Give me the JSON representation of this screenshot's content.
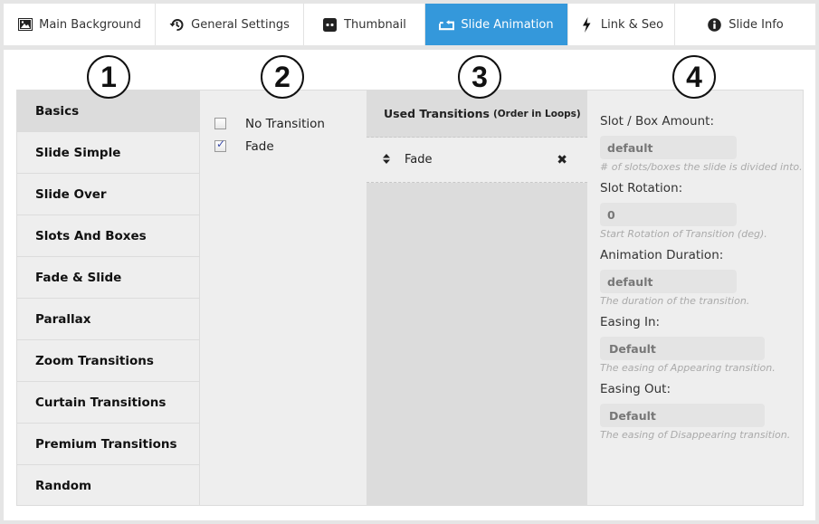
{
  "tabs": [
    {
      "label": "Main Background",
      "icon": "image-icon",
      "active": false
    },
    {
      "label": "General Settings",
      "icon": "history-icon",
      "active": false
    },
    {
      "label": "Thumbnail",
      "icon": "thumbnail-icon",
      "active": false
    },
    {
      "label": "Slide Animation",
      "icon": "loop-icon",
      "active": true
    },
    {
      "label": "Link & Seo",
      "icon": "bolt-icon",
      "active": false
    },
    {
      "label": "Slide Info",
      "icon": "info-icon",
      "active": false
    }
  ],
  "markers": [
    "1",
    "2",
    "3",
    "4"
  ],
  "categories": [
    {
      "label": "Basics",
      "active": true
    },
    {
      "label": "Slide Simple"
    },
    {
      "label": "Slide Over"
    },
    {
      "label": "Slots And Boxes"
    },
    {
      "label": "Fade & Slide"
    },
    {
      "label": "Parallax"
    },
    {
      "label": "Zoom Transitions"
    },
    {
      "label": "Curtain Transitions"
    },
    {
      "label": "Premium Transitions"
    },
    {
      "label": "Random"
    }
  ],
  "transitions": [
    {
      "label": "No Transition",
      "checked": false
    },
    {
      "label": "Fade",
      "checked": true
    }
  ],
  "used": {
    "title": "Used Transitions",
    "subtitle": "(Order in Loops)",
    "items": [
      {
        "label": "Fade",
        "sort_icon": "sort-icon",
        "remove_icon": "close-icon"
      }
    ]
  },
  "settings": [
    {
      "label": "Slot / Box Amount:",
      "value": "default",
      "hint": "# of slots/boxes the slide is divided into."
    },
    {
      "label": "Slot Rotation:",
      "value": "0",
      "hint": "Start Rotation of Transition (deg)."
    },
    {
      "label": "Animation Duration:",
      "value": "default",
      "hint": "The duration of the transition."
    },
    {
      "label": "Easing In:",
      "value": "Default",
      "hint": "The easing of Appearing transition."
    },
    {
      "label": "Easing Out:",
      "value": "Default",
      "hint": "The easing of Disappearing transition."
    }
  ],
  "colors": {
    "accent": "#3498db"
  }
}
